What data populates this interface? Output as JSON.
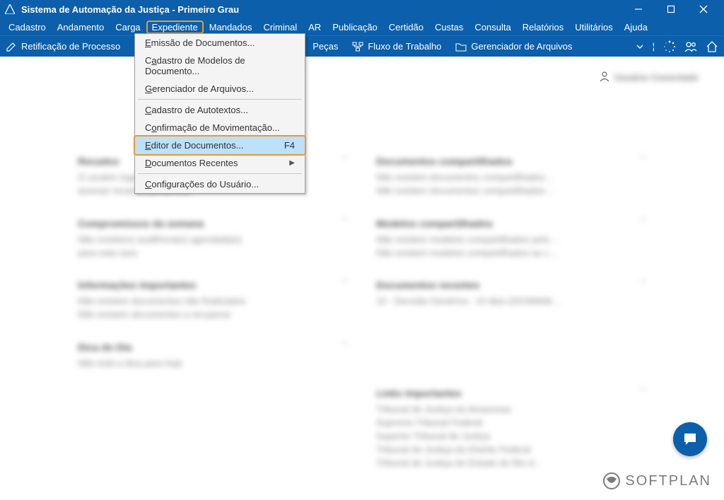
{
  "window": {
    "title": "Sistema de Automação da Justiça - Primeiro Grau"
  },
  "menubar": {
    "items": [
      "Cadastro",
      "Andamento",
      "Carga",
      "Expediente",
      "Mandados",
      "Criminal",
      "AR",
      "Publicação",
      "Certidão",
      "Custas",
      "Consulta",
      "Relatórios",
      "Utilitários",
      "Ajuda"
    ]
  },
  "toolbar": {
    "retificacao": "Retificação de Processo",
    "pecas": "Peças",
    "fluxo": "Fluxo de Trabalho",
    "gerenciador": "Gerenciador de Arquivos"
  },
  "dropdown": {
    "items": [
      {
        "label": "Emissão de Documentos...",
        "underline": "E"
      },
      {
        "label": "Cadastro de Modelos de Documento...",
        "underline": "a"
      },
      {
        "label": "Gerenciador de Arquivos...",
        "underline": "G"
      },
      {
        "sep": true
      },
      {
        "label": "Cadastro de Autotextos...",
        "underline": "C"
      },
      {
        "label": "Confirmação de Movimentação...",
        "underline": "o"
      },
      {
        "label": "Editor de Documentos...",
        "shortcut": "F4",
        "highlight": true,
        "underline": "E"
      },
      {
        "label": "Documentos Recentes",
        "submenu": true,
        "underline": "D"
      },
      {
        "sep": true
      },
      {
        "label": "Configurações do Usuário...",
        "underline": "C"
      }
    ]
  },
  "blurred": {
    "left": [
      {
        "hdr": "Recados",
        "lines": [
          "O usuário logado não possui",
          "acessar recados pendentes"
        ]
      },
      {
        "hdr": "Compromissos da semana",
        "lines": [
          "Não existe(m) audiência(s) agendada(s)",
          "para esta vara."
        ]
      },
      {
        "hdr": "Informações importantes",
        "lines": [
          "Não existem documentos não finalizados",
          "Não existem documentos a recuperar"
        ]
      },
      {
        "hdr": "Dica do Dia",
        "lines": [
          "Não está a dica para hoje"
        ]
      }
    ],
    "right": [
      {
        "hdr": "Documentos compartilhados",
        "lines": [
          "Não existem documentos compartilhados…",
          "Não existem documentos compartilhados…"
        ]
      },
      {
        "hdr": "Modelos compartilhados",
        "lines": [
          "Não existem modelos compartilhados pelo…",
          "Não existem modelos compartilhados as c…"
        ]
      },
      {
        "hdr": "Documentos recentes",
        "lines": [
          "10 - Decisão Genérica - 10 dias (20190836…"
        ]
      },
      {
        "hdr": "Links importantes",
        "lines": [
          "Tribunal de Justiça do Amazonas",
          "Supremo Tribunal Federal",
          "Superior Tribunal de Justiça",
          "Tribunal de Justiça do Distrito Federal",
          "Tribunal de Justiça do Estado do Rio d…"
        ]
      }
    ]
  },
  "logo": {
    "text": "SOFTPLAN"
  }
}
